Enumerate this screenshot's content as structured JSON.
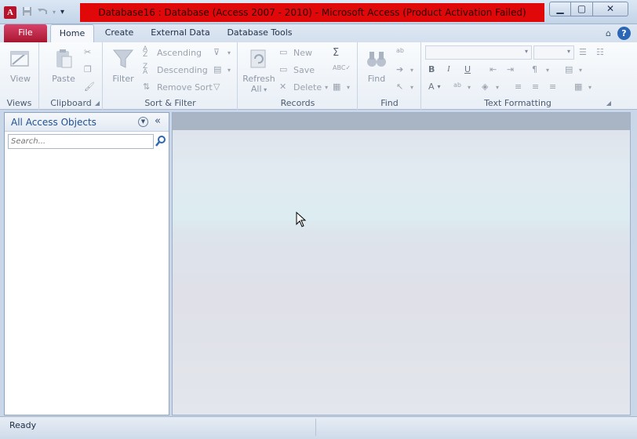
{
  "window": {
    "title": "Database16 : Database (Access 2007 - 2010)  -  Microsoft Access (Product Activation Failed)",
    "app_icon_letter": "A",
    "controls": [
      "minimize-icon",
      "maximize-icon",
      "close-icon"
    ]
  },
  "tabs": {
    "file": "File",
    "home": "Home",
    "create": "Create",
    "external": "External Data",
    "dbtools": "Database Tools",
    "help": "?"
  },
  "ribbon": {
    "views": {
      "label": "Views",
      "view": "View"
    },
    "clipboard": {
      "label": "Clipboard",
      "paste": "Paste"
    },
    "sort_filter": {
      "label": "Sort & Filter",
      "filter": "Filter",
      "ascending": "Ascending",
      "descending": "Descending",
      "remove_sort": "Remove Sort"
    },
    "records": {
      "label": "Records",
      "refresh": "Refresh",
      "refresh_all": "All",
      "new": "New",
      "save": "Save",
      "delete": "Delete"
    },
    "find": {
      "label": "Find",
      "find": "Find"
    },
    "text_formatting": {
      "label": "Text Formatting"
    }
  },
  "nav": {
    "title": "All Access Objects",
    "search_placeholder": "Search..."
  },
  "status": {
    "text": "Ready"
  },
  "colors": {
    "title_bar_alert": "#e00808",
    "file_tab": "#b8132a",
    "accent_blue": "#1f4f8f"
  }
}
